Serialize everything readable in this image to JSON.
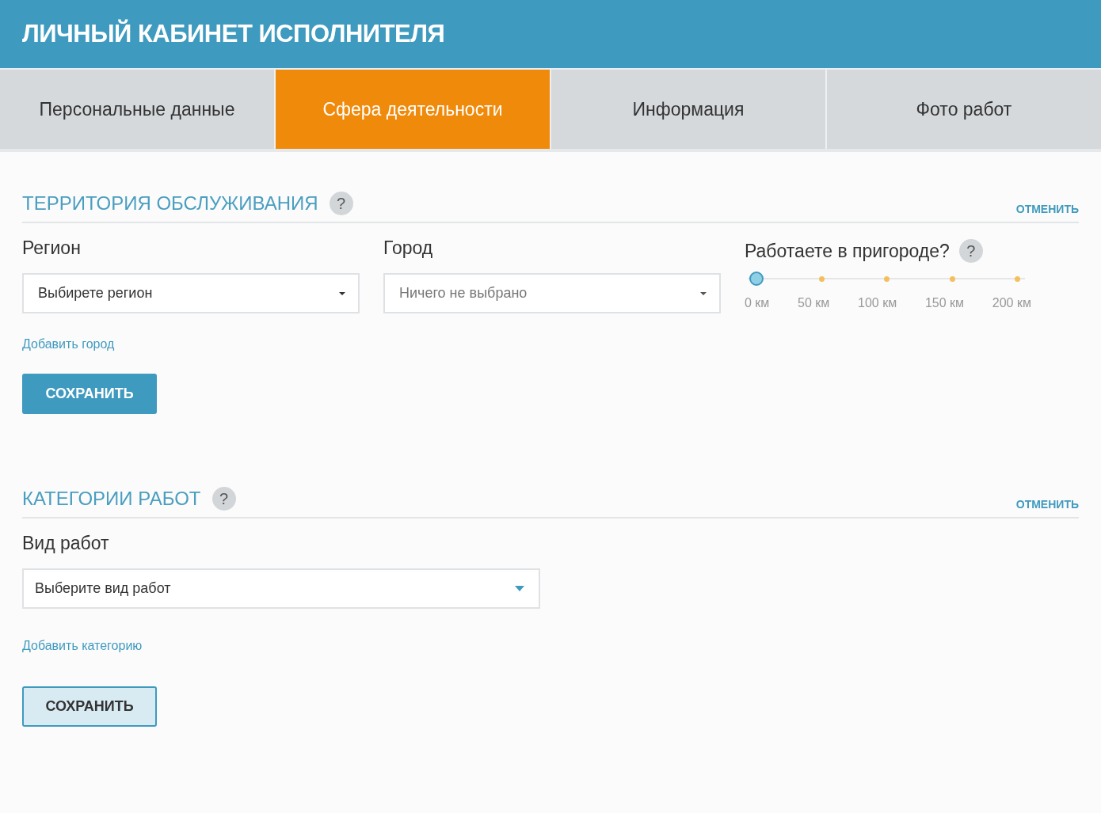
{
  "header": {
    "title": "ЛИЧНЫЙ КАБИНЕТ ИСПОЛНИТЕЛЯ"
  },
  "tabs": [
    {
      "label": "Персональные данные",
      "selected": false
    },
    {
      "label": "Сфера деятельности",
      "selected": true
    },
    {
      "label": "Информация",
      "selected": false
    },
    {
      "label": "Фото работ",
      "selected": false
    }
  ],
  "territory": {
    "title": "ТЕРРИТОРИЯ ОБСЛУЖИВАНИЯ",
    "help": "?",
    "cancel": "ОТМЕНИТЬ",
    "region": {
      "label": "Регион",
      "value": "Выбирете регион"
    },
    "city": {
      "label": "Город",
      "placeholder": "Ничего не выбрано"
    },
    "suburb": {
      "label": "Работаете в пригороде?",
      "help": "?",
      "level": 0,
      "stops": [
        "0 км",
        "50 км",
        "100 км",
        "150 км",
        "200 км"
      ]
    },
    "add_link": "Добавить город",
    "save_button": {
      "label": "СОХРАНИТЬ",
      "kind": "primary"
    }
  },
  "categories": {
    "title": "КАТЕГОРИИ РАБОТ",
    "help": "?",
    "cancel": "ОТМЕНИТЬ",
    "work_type": {
      "label": "Вид работ",
      "value": "Выберите вид работ"
    },
    "add_link": "Добавить категорию",
    "save_button": {
      "label": "СОХРАНИТЬ",
      "kind": "secondary"
    }
  }
}
